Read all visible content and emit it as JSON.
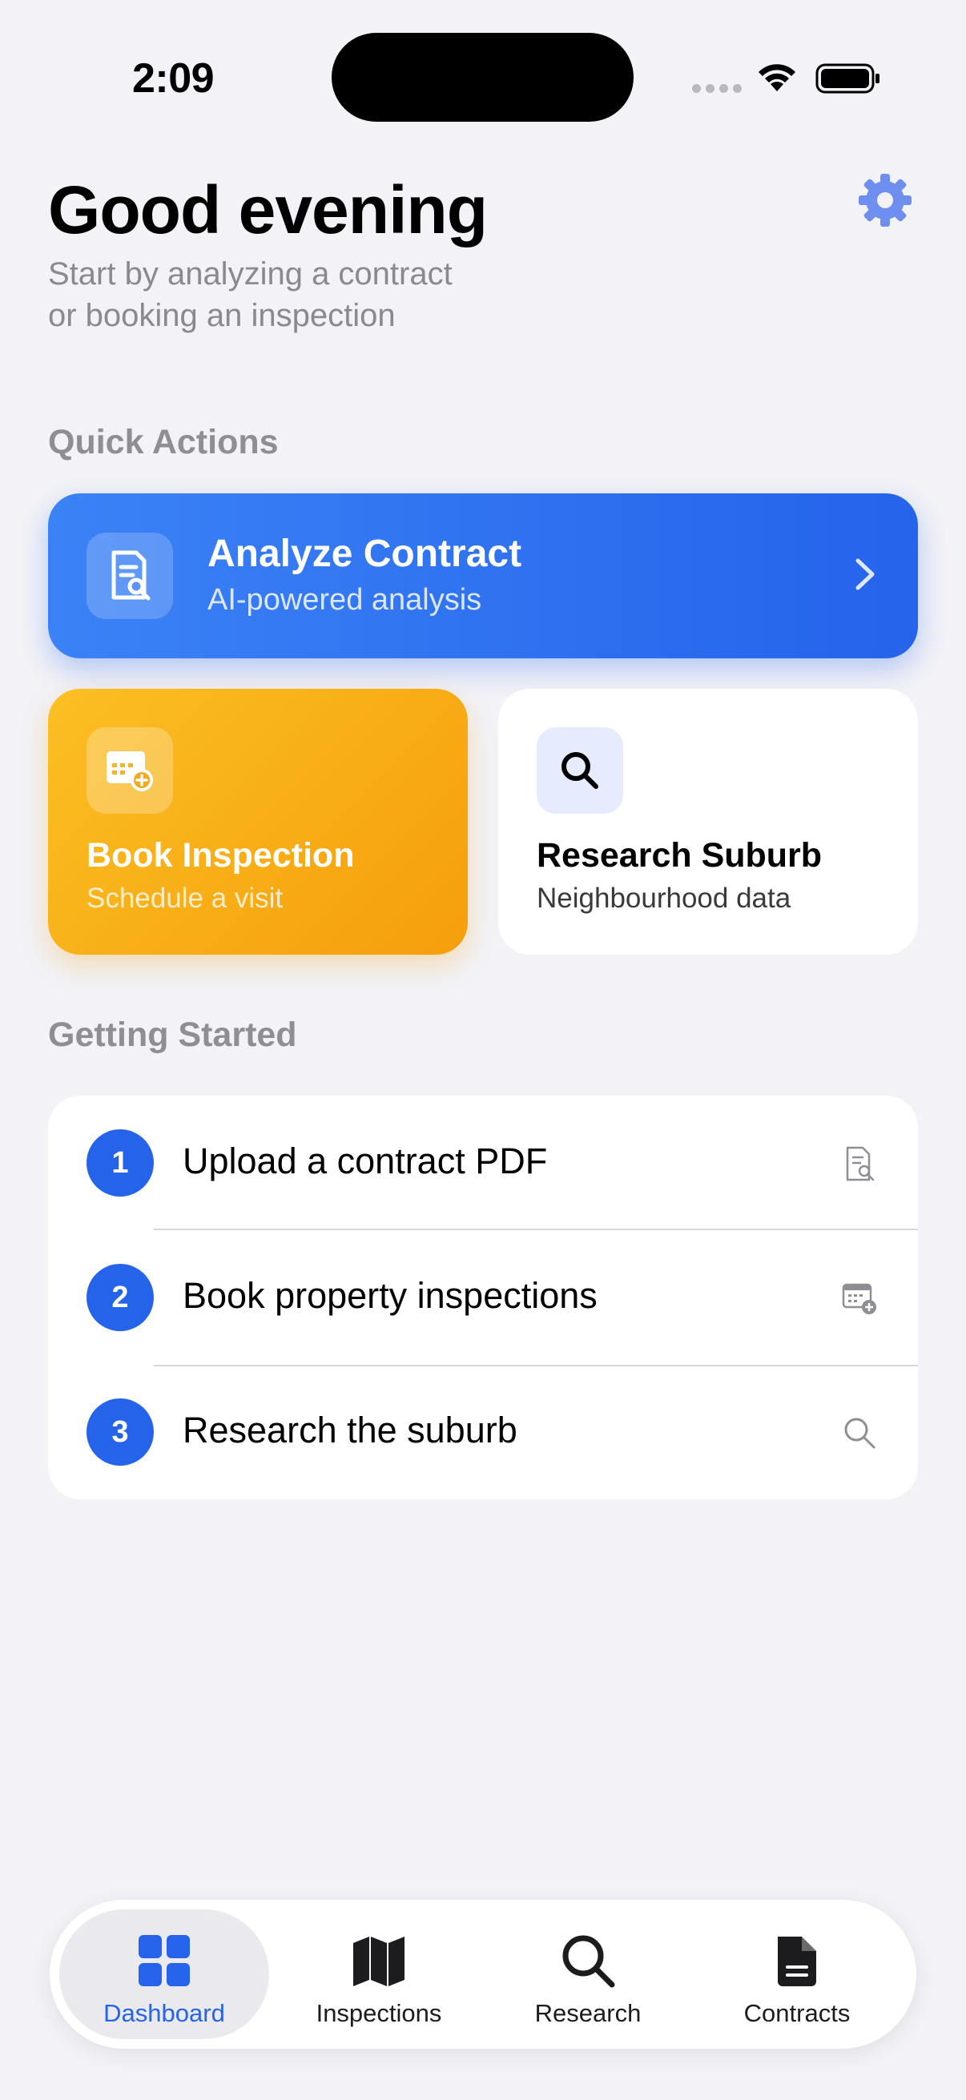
{
  "status_bar": {
    "time": "2:09"
  },
  "header": {
    "greeting": "Good evening",
    "subtitle_line1": "Start by analyzing a contract",
    "subtitle_line2": "or booking an inspection"
  },
  "quick_actions": {
    "heading": "Quick Actions",
    "analyze": {
      "title": "Analyze Contract",
      "subtitle": "AI-powered analysis"
    },
    "book": {
      "title": "Book Inspection",
      "subtitle": "Schedule a visit"
    },
    "research": {
      "title": "Research Suburb",
      "subtitle": "Neighbourhood data"
    }
  },
  "getting_started": {
    "heading": "Getting Started",
    "steps": [
      {
        "number": "1",
        "label": "Upload a contract PDF",
        "icon": "document-search-icon"
      },
      {
        "number": "2",
        "label": "Book property inspections",
        "icon": "calendar-add-icon"
      },
      {
        "number": "3",
        "label": "Research the suburb",
        "icon": "search-icon"
      }
    ]
  },
  "tabbar": {
    "items": [
      {
        "label": "Dashboard",
        "icon": "grid-icon",
        "active": true
      },
      {
        "label": "Inspections",
        "icon": "map-icon",
        "active": false
      },
      {
        "label": "Research",
        "icon": "search-icon",
        "active": false
      },
      {
        "label": "Contracts",
        "icon": "document-icon",
        "active": false
      }
    ]
  },
  "colors": {
    "primary_blue": "#2563eb",
    "amber": "#f59e0b",
    "gear": "#6f8ff0",
    "background": "#f2f2f7"
  }
}
